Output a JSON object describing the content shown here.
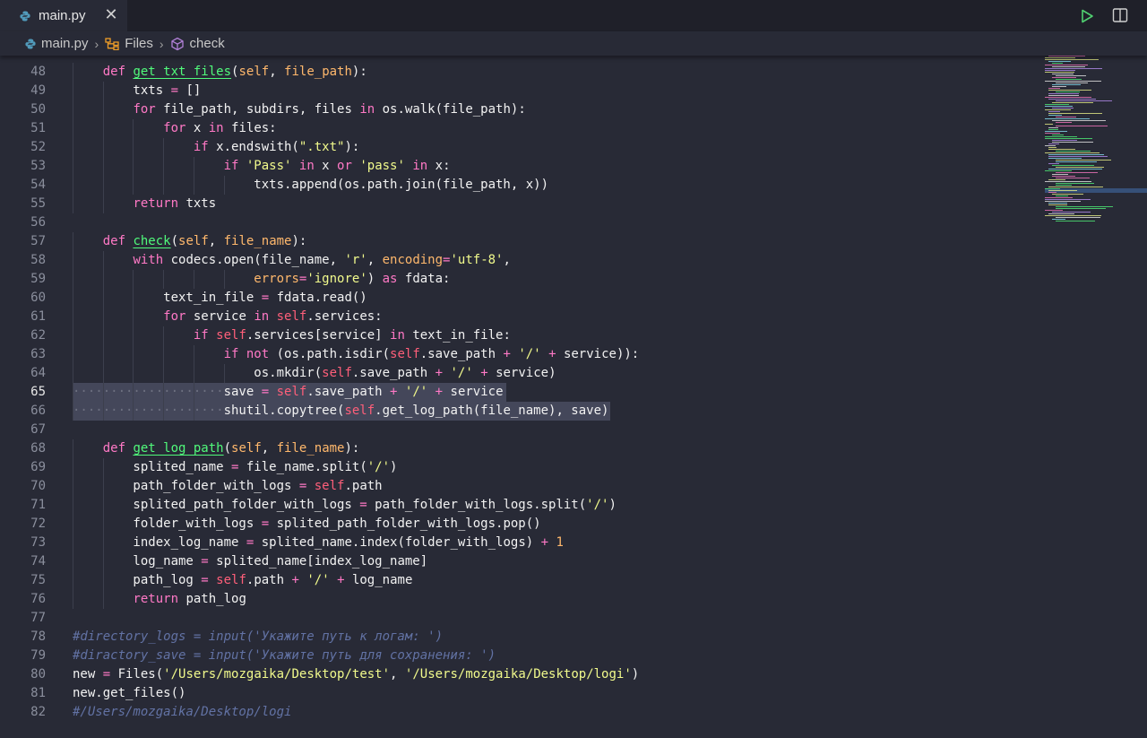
{
  "tab": {
    "label": "main.py",
    "close_glyph": "✕"
  },
  "toolbar": {
    "run_icon": "run-icon",
    "split_icon": "split-editor-icon"
  },
  "breadcrumb": {
    "file": "main.py",
    "class_name": "Files",
    "method": "check",
    "separator": "›"
  },
  "editor": {
    "active_line": 65,
    "lines": [
      {
        "n": 48,
        "html": "    <span class=\"kw\">def</span> <span class=\"fn\">get_txt_files</span>(<span class=\"pa\">self</span>, <span class=\"pa\">file_path</span>):"
      },
      {
        "n": 49,
        "html": "        txts <span class=\"op\">=</span> []"
      },
      {
        "n": 50,
        "html": "        <span class=\"kw\">for</span> file_path, subdirs, files <span class=\"kw\">in</span> os.walk(file_path):"
      },
      {
        "n": 51,
        "html": "            <span class=\"kw\">for</span> x <span class=\"kw\">in</span> files:"
      },
      {
        "n": 52,
        "html": "                <span class=\"kw\">if</span> x.endswith(<span class=\"st\">\".txt\"</span>):"
      },
      {
        "n": 53,
        "html": "                    <span class=\"kw\">if</span> <span class=\"st\">'Pass'</span> <span class=\"kw\">in</span> x <span class=\"kw\">or</span> <span class=\"st\">'pass'</span> <span class=\"kw\">in</span> x:"
      },
      {
        "n": 54,
        "html": "                        txts.append(os.path.join(file_path, x))"
      },
      {
        "n": 55,
        "html": "        <span class=\"kw\">return</span> txts"
      },
      {
        "n": 56,
        "html": ""
      },
      {
        "n": 57,
        "html": "    <span class=\"kw\">def</span> <span class=\"fn\">check</span>(<span class=\"pa\">self</span>, <span class=\"pa\">file_name</span>):"
      },
      {
        "n": 58,
        "html": "        <span class=\"kw\">with</span> codecs.open(file_name, <span class=\"st\">'r'</span>, <span class=\"pa\">encoding</span><span class=\"op\">=</span><span class=\"st\">'utf-8'</span>,"
      },
      {
        "n": 59,
        "html": "                        <span class=\"pa\">errors</span><span class=\"op\">=</span><span class=\"st\">'ignore'</span>) <span class=\"kw\">as</span> fdata:"
      },
      {
        "n": 60,
        "html": "            text_in_file <span class=\"op\">=</span> fdata.read()"
      },
      {
        "n": 61,
        "html": "            <span class=\"kw\">for</span> service <span class=\"kw\">in</span> <span class=\"sf\">self</span>.services:"
      },
      {
        "n": 62,
        "html": "                <span class=\"kw\">if</span> <span class=\"sf\">self</span>.services[service] <span class=\"kw\">in</span> text_in_file:"
      },
      {
        "n": 63,
        "html": "                    <span class=\"kw\">if</span> <span class=\"kw\">not</span> (os.path.isdir(<span class=\"sf\">self</span>.save_path <span class=\"op\">+</span> <span class=\"st\">'/'</span> <span class=\"op\">+</span> service)):"
      },
      {
        "n": 64,
        "html": "                        os.mkdir(<span class=\"sf\">self</span>.save_path <span class=\"op\">+</span> <span class=\"st\">'/'</span> <span class=\"op\">+</span> service)"
      },
      {
        "n": 65,
        "html": "<span class=\"ws\">····················</span>save <span class=\"op\">=</span> <span class=\"sf\">self</span>.save_path <span class=\"op\">+</span> <span class=\"st\">'/'</span> <span class=\"op\">+</span> service ",
        "sel": 484
      },
      {
        "n": 66,
        "html": "<span class=\"ws\">····················</span>shutil.copytree(<span class=\"sf\">self</span>.get_log_path(file_name), save)",
        "sel": 600
      },
      {
        "n": 67,
        "html": ""
      },
      {
        "n": 68,
        "html": "    <span class=\"kw\">def</span> <span class=\"fn\">get_log_path</span>(<span class=\"pa\">self</span>, <span class=\"pa\">file_name</span>):"
      },
      {
        "n": 69,
        "html": "        splited_name <span class=\"op\">=</span> file_name.split(<span class=\"st\">'/'</span>)"
      },
      {
        "n": 70,
        "html": "        path_folder_with_logs <span class=\"op\">=</span> <span class=\"sf\">self</span>.path"
      },
      {
        "n": 71,
        "html": "        splited_path_folder_with_logs <span class=\"op\">=</span> path_folder_with_logs.split(<span class=\"st\">'/'</span>)"
      },
      {
        "n": 72,
        "html": "        folder_with_logs <span class=\"op\">=</span> splited_path_folder_with_logs.pop()"
      },
      {
        "n": 73,
        "html": "        index_log_name <span class=\"op\">=</span> splited_name.index(folder_with_logs) <span class=\"op\">+</span> <span class=\"pa\">1</span>"
      },
      {
        "n": 74,
        "html": "        log_name <span class=\"op\">=</span> splited_name[index_log_name]"
      },
      {
        "n": 75,
        "html": "        path_log <span class=\"op\">=</span> <span class=\"sf\">self</span>.path <span class=\"op\">+</span> <span class=\"st\">'/'</span> <span class=\"op\">+</span> log_name"
      },
      {
        "n": 76,
        "html": "        <span class=\"kw\">return</span> path_log"
      },
      {
        "n": 77,
        "html": ""
      },
      {
        "n": 78,
        "html": "<span class=\"cm\">#directory_logs = input('Укажите путь к логам: ')</span>"
      },
      {
        "n": 79,
        "html": "<span class=\"cm\">#diractory_save = input('Укажите путь для сохранения: ')</span>"
      },
      {
        "n": 80,
        "html": "new <span class=\"op\">=</span> Files(<span class=\"st\">'/Users/mozgaika/Desktop/test'</span>, <span class=\"st\">'/Users/mozgaika/Desktop/logi'</span>)"
      },
      {
        "n": 81,
        "html": "new.get_files()"
      },
      {
        "n": 82,
        "html": "<span class=\"cm\">#/Users/mozgaika/Desktop/logi</span>"
      }
    ]
  }
}
